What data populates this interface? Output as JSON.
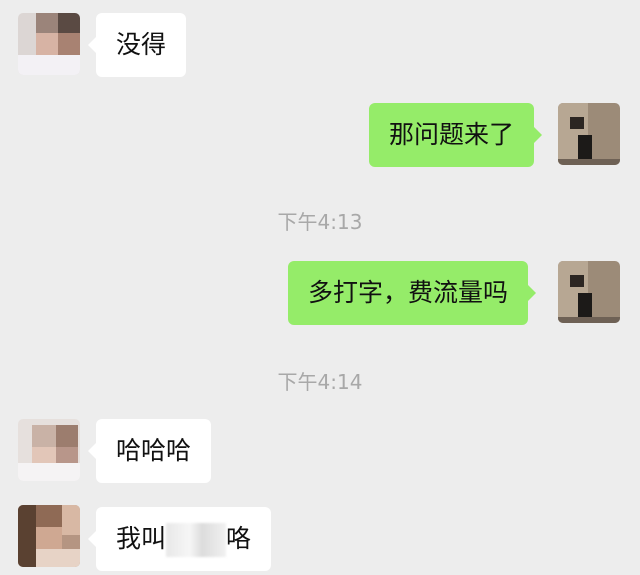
{
  "chat": {
    "messages": [
      {
        "side": "in",
        "text": "没得"
      },
      {
        "side": "out",
        "text": "那问题来了"
      },
      {
        "timestamp": "下午4:13"
      },
      {
        "side": "out",
        "text": "多打字，费流量吗"
      },
      {
        "timestamp": "下午4:14"
      },
      {
        "side": "in",
        "text": "哈哈哈"
      },
      {
        "side": "in",
        "text_prefix": "我叫",
        "text_suffix": "咯"
      }
    ]
  },
  "colors": {
    "background": "#ededed",
    "incoming_bubble": "#ffffff",
    "outgoing_bubble": "#95ec69",
    "timestamp_text": "#a8a8a8"
  },
  "icons": {
    "contact_avatar": "pixelated-avatar-icon",
    "self_avatar": "photo-avatar-icon"
  }
}
